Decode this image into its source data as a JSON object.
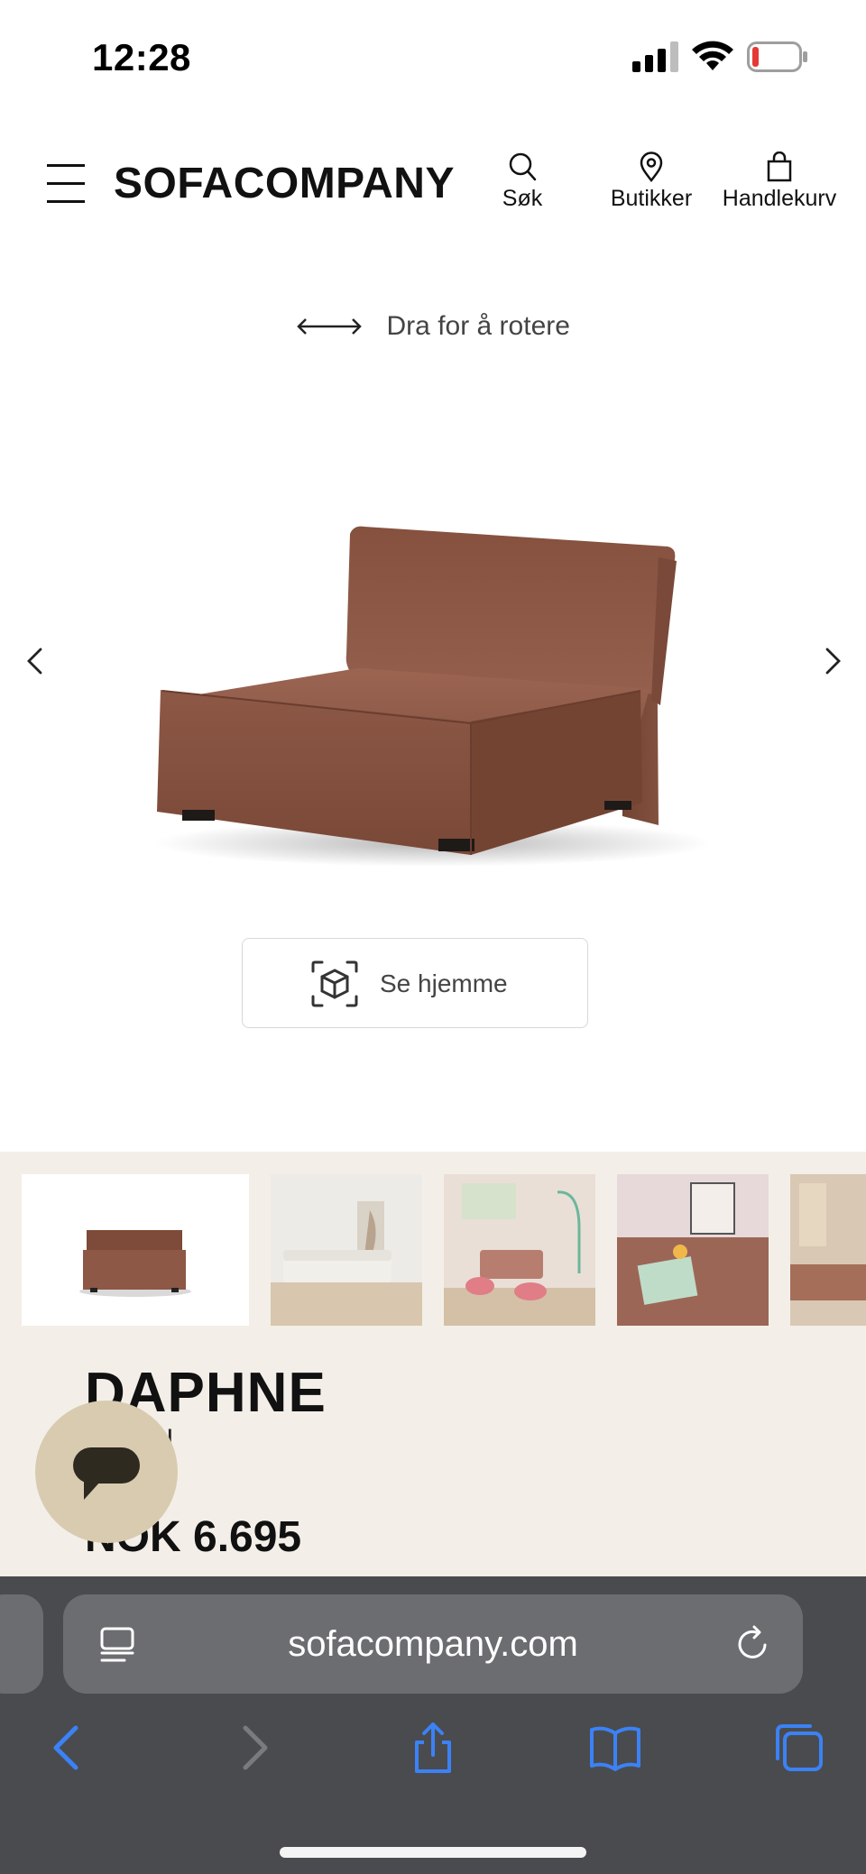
{
  "status_bar": {
    "time": "12:28",
    "icons": [
      "cellular-signal-icon",
      "wifi-icon",
      "battery-low-icon"
    ]
  },
  "header": {
    "logo": "SOFACOMPANY",
    "menu_icon": "hamburger-menu-icon",
    "nav": [
      {
        "label": "Søk",
        "icon": "search-icon"
      },
      {
        "label": "Butikker",
        "icon": "location-pin-icon"
      },
      {
        "label": "Handlekurv",
        "icon": "shopping-bag-icon"
      }
    ]
  },
  "viewer": {
    "rotate_hint": "Dra for å rotere",
    "rotate_icon": "double-arrow-icon",
    "prev_icon": "chevron-left-icon",
    "next_icon": "chevron-right-icon",
    "ar_button_label": "Se hjemme",
    "ar_icon": "ar-cube-icon"
  },
  "product": {
    "name": "DAPHNE",
    "subtitle": "rmodul",
    "price": "NOK 6.695",
    "fine_print": "...",
    "thumbnail_count": 5
  },
  "chat": {
    "icon": "chat-bubble-icon"
  },
  "browser": {
    "url": "sofacompany.com",
    "reader_icon": "reader-mode-icon",
    "reload_icon": "reload-icon",
    "toolbar": [
      "back-arrow-icon",
      "forward-arrow-icon",
      "share-icon",
      "bookmarks-icon",
      "tabs-icon"
    ]
  },
  "colors": {
    "sofa_fabric": "#8a5644",
    "info_background": "#f3efe8",
    "chat_fab": "#d8cbb0",
    "browser_chrome": "#4a4b4e",
    "safari_blue": "#3b82f6",
    "battery_red": "#e53935"
  }
}
